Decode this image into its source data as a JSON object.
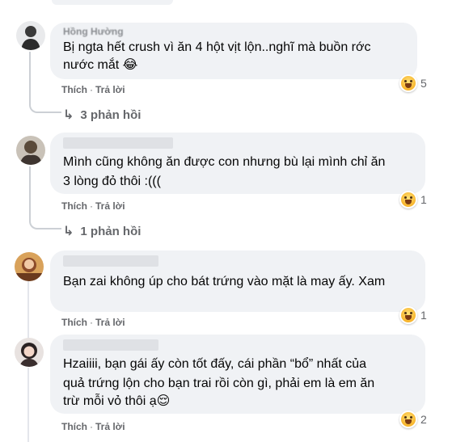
{
  "comments": [
    {
      "author": "Hồng Hường",
      "text_lines": [
        "Bị ngta hết crush vì ăn 4 hột vịt lộn..nghĩ mà buồn rớc",
        "nước mắt 😂"
      ],
      "like_label": "Thích",
      "reply_label": "Trả lời",
      "reaction_icon": "haha-icon",
      "reaction_count": "5",
      "replies_label": "3 phản hồi"
    },
    {
      "author": "",
      "text_lines": [
        "Mình cũng không ăn được con nhưng bù lại mình chỉ ăn",
        "3 lòng đỏ thôi :((("
      ],
      "like_label": "Thích",
      "reply_label": "Trả lời",
      "reaction_icon": "haha-icon",
      "reaction_count": "1",
      "replies_label": "1 phản hồi"
    },
    {
      "author": "",
      "text_lines": [
        "Bạn zai không úp cho bát trứng vào mặt là may ấy. Xam"
      ],
      "like_label": "Thích",
      "reply_label": "Trả lời",
      "reaction_icon": "haha-icon",
      "reaction_count": "1"
    },
    {
      "author": "",
      "text_lines": [
        "Hzaiiii, bạn gái ấy còn tốt đấy, cái phần “bổ” nhất của",
        "quả trứng lộn cho bạn trai rồi còn gì, phải em là em ăn",
        "trừ mỗi vỏ thôi ạ😌"
      ],
      "like_label": "Thích",
      "reply_label": "Trả lời",
      "reaction_icon": "haha-icon",
      "reaction_count": "2"
    }
  ],
  "colors": {
    "bubble": "#f0f2f5",
    "action_text": "#65676b",
    "thread_line": "#ccd0d5"
  }
}
